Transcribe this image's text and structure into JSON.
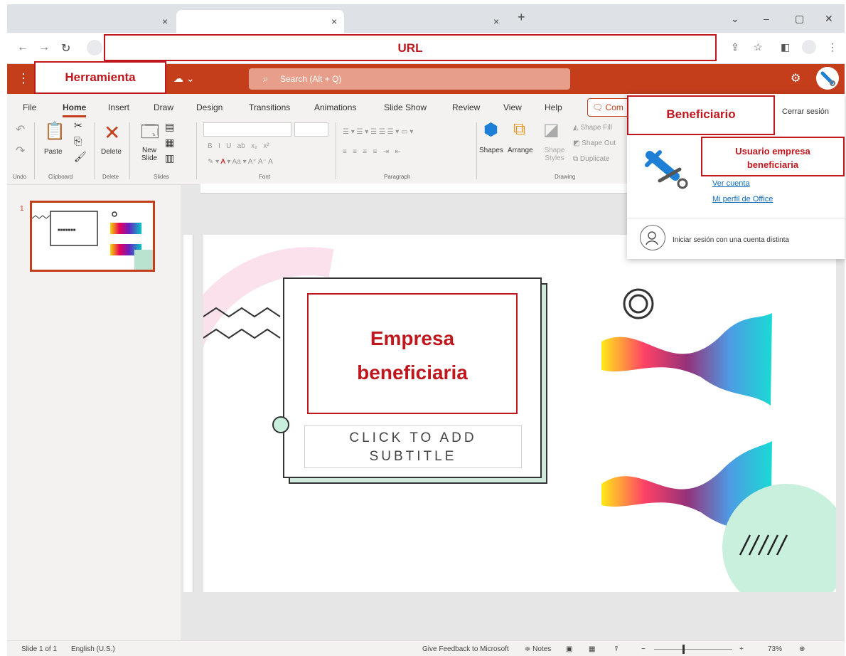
{
  "browser": {
    "tab_close": "×",
    "new_tab": "+",
    "win_min": "–",
    "win_max": "▢",
    "win_close": "✕",
    "win_more": "⌄"
  },
  "annotations": {
    "url": "URL",
    "tool": "Herramienta",
    "beneficiary": "Beneficiario",
    "user_line1": "Usuario empresa",
    "user_line2": "beneficiaria",
    "slide_title_line1": "Empresa",
    "slide_title_line2": "beneficiaria"
  },
  "office": {
    "search_placeholder": "Search (Alt + Q)"
  },
  "ribbon": {
    "tabs": [
      "File",
      "Home",
      "Insert",
      "Draw",
      "Design",
      "Transitions",
      "Animations",
      "Slide Show",
      "Review",
      "View",
      "Help"
    ],
    "comments": "Com",
    "paste": "Paste",
    "delete": "Delete",
    "new_slide": "New Slide",
    "shapes": "Shapes",
    "arrange": "Arrange",
    "shape_styles": "Shape Styles",
    "shape_fill": "Shape Fill",
    "shape_outline": "Shape Out",
    "duplicate": "Duplicate",
    "groups": [
      "Undo",
      "Clipboard",
      "Delete",
      "Slides",
      "Font",
      "Paragraph",
      "Drawing"
    ]
  },
  "account": {
    "sign_out": "Cerrar sesión",
    "view_account": "Ver cuenta",
    "office_profile": "Mi perfil de Office",
    "other_account": "Iniciar sesión con una cuenta distinta"
  },
  "slide": {
    "subtitle_line1": "CLICK TO ADD",
    "subtitle_line2": "SUBTITLE",
    "thumb_number": "1"
  },
  "status": {
    "slide_info": "Slide 1 of 1",
    "language": "English (U.S.)",
    "feedback": "Give Feedback to Microsoft",
    "notes": "Notes",
    "zoom": "73%"
  },
  "colors": {
    "office_brand": "#c43e1c",
    "annotation_red": "#c0161d"
  }
}
